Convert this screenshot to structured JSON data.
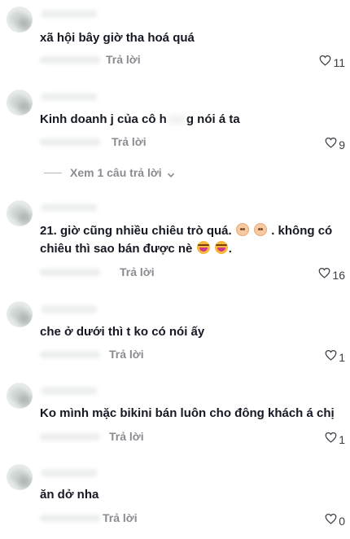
{
  "reply_label": "Trả lời",
  "view_replies": "Xem 1 câu trả lời",
  "comments": [
    {
      "text": "xã hội bây giờ tha hoá quá",
      "likes": "11"
    },
    {
      "text_before": "Kinh doanh j của cô h",
      "text_after": "g nói á ta",
      "likes": "9"
    },
    {
      "line1": "21. giờ cũng nhiều chiêu trò quá.",
      "line1_after": ". không có",
      "line2": "chiêu thì sao bán được nè",
      "line2_after": ".",
      "likes": "16"
    },
    {
      "text": "che ở dưới thì t ko có nói ấy",
      "likes": "1"
    },
    {
      "text": "Ko mình mặc bikini bán luôn cho đông khách á chị",
      "likes": "1"
    },
    {
      "text": "ăn dở nha",
      "likes": "0"
    }
  ],
  "colors": {
    "text": "#161823",
    "secondary": "#8a8b91"
  },
  "icons": {
    "like": "heart-outline-icon",
    "chevron": "chevron-down-icon"
  }
}
